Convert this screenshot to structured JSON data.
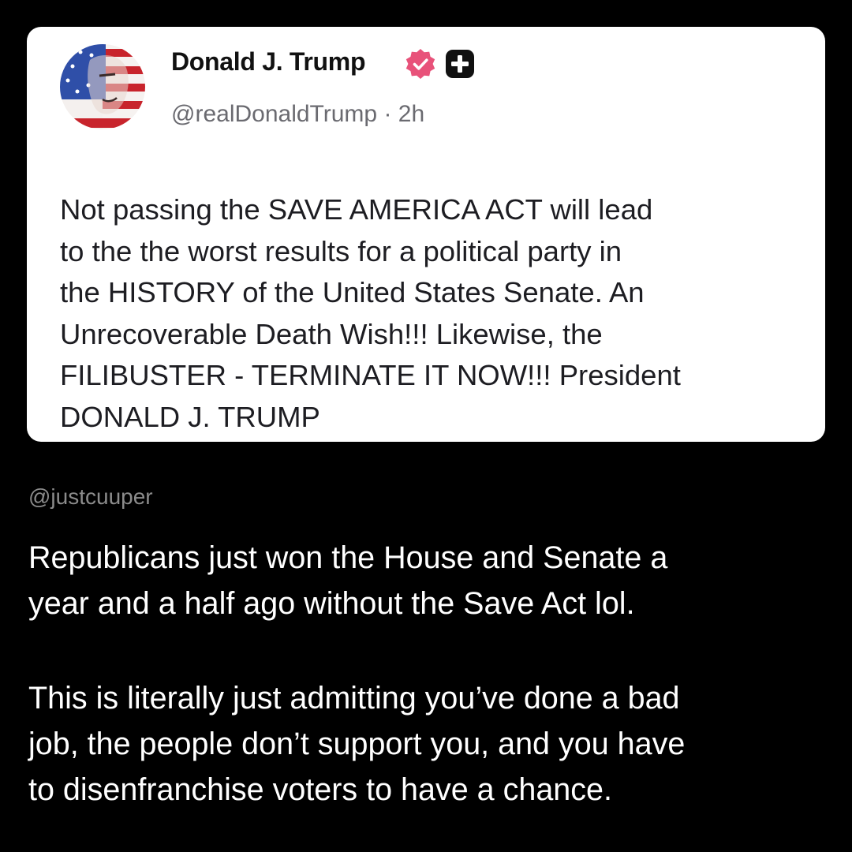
{
  "post": {
    "author_name": "Donald J. Trump",
    "handle_line": "@realDonaldTrump · 2h",
    "body": "Not passing the SAVE AMERICA ACT will lead\nto the the worst results for a political party in\nthe HISTORY of the United States Senate. An\nUnrecoverable Death Wish!!! Likewise, the\nFILIBUSTER - TERMINATE IT NOW!!! President\nDONALD J. TRUMP",
    "icons": {
      "verified": "verified-badge-icon",
      "plus": "plus-badge-icon"
    }
  },
  "comment": {
    "handle": "@justcuuper",
    "paragraphs": [
      "Republicans just won the House and Senate a\nyear and a half ago without the Save Act lol.",
      "This is literally just admitting you’ve done a bad\njob, the people don’t support you, and you have\nto disenfranchise voters to have a chance."
    ]
  },
  "colors": {
    "page_background": "#000000",
    "card_background": "#ffffff",
    "verified_badge": "#e8527a",
    "plus_badge": "#111111",
    "comment_handle": "#8b8b8b",
    "comment_text": "#ffffff"
  }
}
